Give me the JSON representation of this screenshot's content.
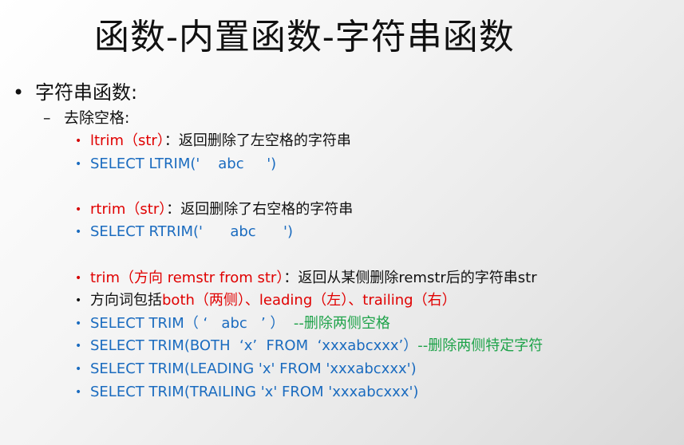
{
  "title": "函数-内置函数-字符串函数",
  "level1": {
    "bullet": "•",
    "text": "字符串函数:"
  },
  "level2": {
    "dash": "–",
    "text": "去除空格:"
  },
  "items": [
    {
      "bullet": "•",
      "parts": [
        {
          "text": "ltrim（str）",
          "color": "red"
        },
        {
          "text": "：返回删除了左空格的字符串",
          "color": "black"
        }
      ]
    },
    {
      "bullet": "•",
      "parts": [
        {
          "text": "SELECT LTRIM('    abc     ')",
          "color": "blue"
        }
      ]
    },
    {
      "bullet": "•",
      "parts": [
        {
          "text": "rtrim（str）",
          "color": "red"
        },
        {
          "text": "：返回删除了右空格的字符串",
          "color": "black"
        }
      ]
    },
    {
      "bullet": "•",
      "parts": [
        {
          "text": "SELECT RTRIM('      abc      ')",
          "color": "blue"
        }
      ]
    },
    {
      "bullet": "•",
      "parts": [
        {
          "text": "trim（方向 remstr from str）",
          "color": "red"
        },
        {
          "text": "：返回从某侧删除remstr后的字符串str",
          "color": "black"
        }
      ]
    },
    {
      "bullet": "•",
      "parts": [
        {
          "text": "方向词包括",
          "color": "black"
        },
        {
          "text": "both（两侧）、leading（左）、trailing（右）",
          "color": "red"
        }
      ]
    },
    {
      "bullet": "•",
      "parts": [
        {
          "text": "SELECT TRIM（ ‘   abc   ’ ）",
          "color": "blue"
        },
        {
          "text": "  --删除两侧空格",
          "color": "green"
        }
      ]
    },
    {
      "bullet": "•",
      "parts": [
        {
          "text": "SELECT TRIM(BOTH  ‘x’  FROM  ‘xxxabcxxx’）",
          "color": "blue"
        },
        {
          "text": "--删除两侧特定字符",
          "color": "green"
        }
      ]
    },
    {
      "bullet": "•",
      "parts": [
        {
          "text": "SELECT TRIM(LEADING 'x' FROM 'xxxabcxxx')",
          "color": "blue"
        }
      ]
    },
    {
      "bullet": "•",
      "parts": [
        {
          "text": "SELECT TRIM(TRAILING 'x' FROM 'xxxabcxxx')",
          "color": "blue"
        }
      ]
    }
  ],
  "colors": {
    "red": "#e00000",
    "blue": "#1a6bbf",
    "green": "#1fa34a",
    "black": "#111111"
  }
}
